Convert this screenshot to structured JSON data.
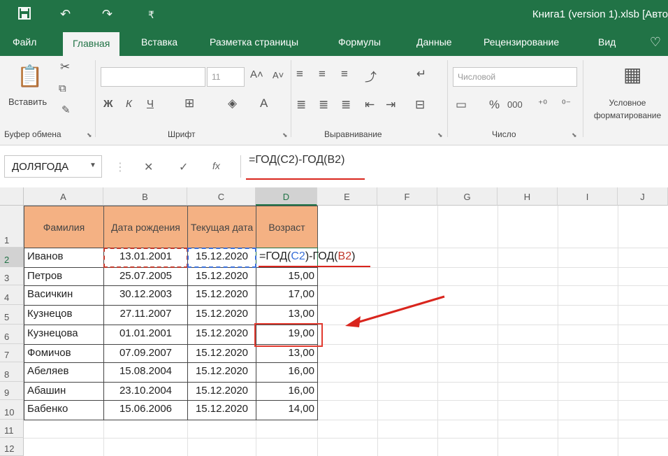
{
  "window": {
    "title": "Книга1 (version 1).xlsb [Авто"
  },
  "quick_access": {
    "save_icon": "save-icon",
    "undo_icon": "undo-icon",
    "redo_icon": "redo-icon",
    "customize_icon": "customize-icon"
  },
  "tabs": [
    {
      "label": "Файл"
    },
    {
      "label": "Главная"
    },
    {
      "label": "Вставка"
    },
    {
      "label": "Разметка страницы"
    },
    {
      "label": "Формулы"
    },
    {
      "label": "Данные"
    },
    {
      "label": "Рецензирование"
    },
    {
      "label": "Вид"
    }
  ],
  "ribbon": {
    "paste_label": "Вставить",
    "font_size": "11",
    "bold": "Ж",
    "italic": "К",
    "underline": "Ч",
    "number_format": "Числовой",
    "percent": "%",
    "thousands": "000",
    "conditional_format": "Условное форматирование",
    "groups": {
      "clipboard": "Буфер обмена",
      "font": "Шрифт",
      "alignment": "Выравнивание",
      "number": "Число"
    }
  },
  "formula_bar": {
    "name_box": "ДОЛЯГОДА",
    "formula": "=ГОД(C2)-ГОД(B2)",
    "cancel_icon": "cancel-icon",
    "enter_icon": "check-icon",
    "fx": "fx"
  },
  "sheet": {
    "columns": [
      "A",
      "B",
      "C",
      "D",
      "E",
      "F",
      "G",
      "H",
      "I",
      "J"
    ],
    "rows": [
      "1",
      "2",
      "3",
      "4",
      "5",
      "6",
      "7",
      "8",
      "9",
      "10",
      "11",
      "12"
    ],
    "headers": [
      "Фамилия",
      "Дата рождения",
      "Текущая дата",
      "Возраст"
    ],
    "data": [
      {
        "name": "Иванов",
        "birth": "13.01.2001",
        "current": "15.12.2020",
        "age": "=ГОД(C2)-ГОД(B2)"
      },
      {
        "name": "Петров",
        "birth": "25.07.2005",
        "current": "15.12.2020",
        "age": "15,00"
      },
      {
        "name": "Васичкин",
        "birth": "30.12.2003",
        "current": "15.12.2020",
        "age": "17,00"
      },
      {
        "name": "Кузнецов",
        "birth": "27.11.2007",
        "current": "15.12.2020",
        "age": "13,00"
      },
      {
        "name": "Кузнецова",
        "birth": "01.01.2001",
        "current": "15.12.2020",
        "age": "19,00"
      },
      {
        "name": "Фомичов",
        "birth": "07.09.2007",
        "current": "15.12.2020",
        "age": "13,00"
      },
      {
        "name": "Абеляев",
        "birth": "15.08.2004",
        "current": "15.12.2020",
        "age": "16,00"
      },
      {
        "name": "Абашин",
        "birth": "23.10.2004",
        "current": "15.12.2020",
        "age": "16,00"
      },
      {
        "name": "Бабенко",
        "birth": "15.06.2006",
        "current": "15.12.2020",
        "age": "14,00"
      }
    ],
    "formula_parts": {
      "prefix": "=ГОД(",
      "c_ref": "C2",
      "mid": ")-ГОД(",
      "b_ref": "B2",
      "suffix": ")"
    },
    "colors": {
      "header_fill": "#f4b183",
      "accent": "#217346",
      "annotation": "#e23a2f"
    }
  }
}
